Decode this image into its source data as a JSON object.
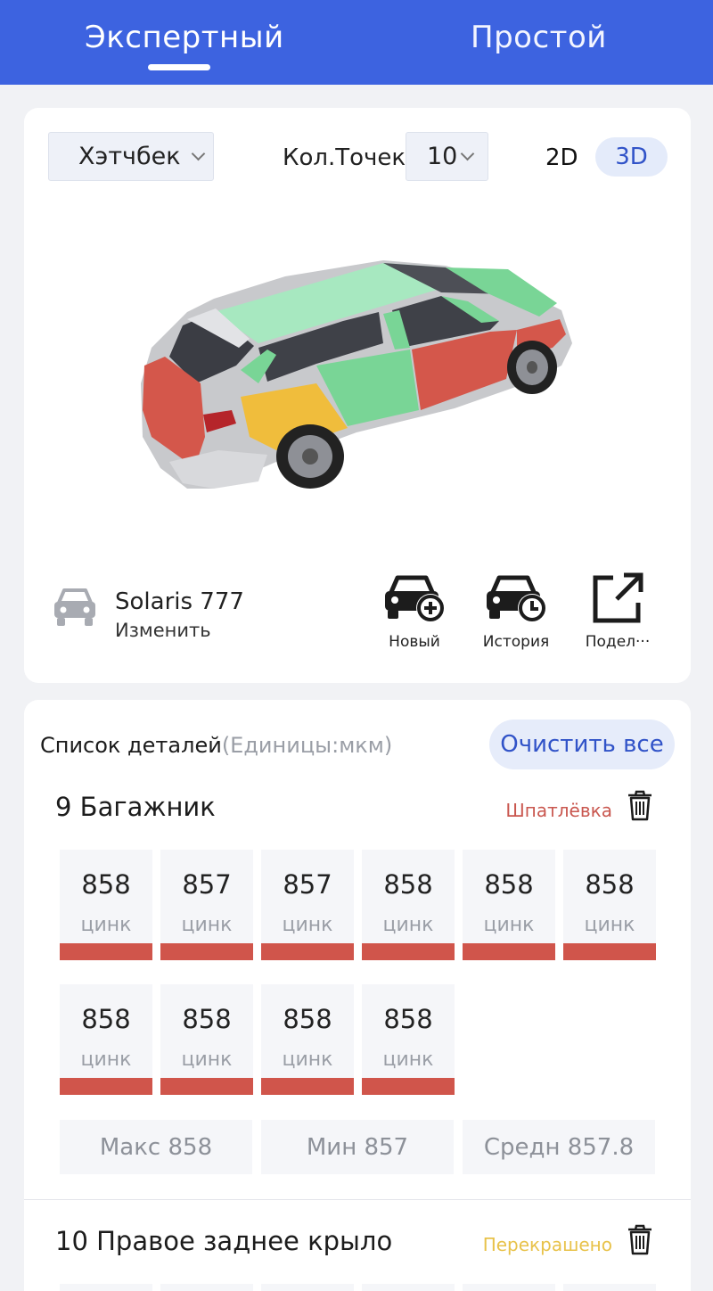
{
  "tabs": {
    "expert": "Экспертный",
    "simple": "Простой",
    "active": "expert"
  },
  "toolbar": {
    "body_type": "Хэтчбек",
    "points_label": "Кол.Точек",
    "points_value": "10",
    "view_2d": "2D",
    "view_3d": "3D",
    "active_view": "3D"
  },
  "vehicle": {
    "name": "Solaris 777",
    "change_label": "Изменить"
  },
  "actions": {
    "new_label": "Новый",
    "history_label": "История",
    "share_label": "Подел···"
  },
  "list": {
    "title": "Список деталей",
    "units": "(Единицы:мкм)",
    "clear_all": "Очистить все"
  },
  "parts": [
    {
      "name": "9 Багажник",
      "status": "Шпатлёвка",
      "status_color": "#c9574f",
      "measurements": [
        {
          "value": "858",
          "material": "цинк"
        },
        {
          "value": "857",
          "material": "цинк"
        },
        {
          "value": "857",
          "material": "цинк"
        },
        {
          "value": "858",
          "material": "цинк"
        },
        {
          "value": "858",
          "material": "цинк"
        },
        {
          "value": "858",
          "material": "цинк"
        },
        {
          "value": "858",
          "material": "цинк"
        },
        {
          "value": "858",
          "material": "цинк"
        },
        {
          "value": "858",
          "material": "цинк"
        },
        {
          "value": "858",
          "material": "цинк"
        }
      ],
      "bar_color": "#d0554b",
      "stats": {
        "max": "Макс 858",
        "min": "Мин 857",
        "avg": "Средн 857.8"
      }
    },
    {
      "name": "10 Правое заднее крыло",
      "status": "Перекрашено",
      "status_color": "#e8c24a"
    }
  ],
  "colors": {
    "header_bg": "#3d63e0",
    "accent": "#3153c8",
    "red_zone": "#d4574b",
    "yellow_zone": "#f0bd3c",
    "green_zone": "#79d596",
    "light_green_zone": "#a7e8c0"
  },
  "icons": [
    "chevron-down-icon",
    "car-icon",
    "car-add-icon",
    "car-history-icon",
    "share-icon",
    "trash-icon"
  ]
}
